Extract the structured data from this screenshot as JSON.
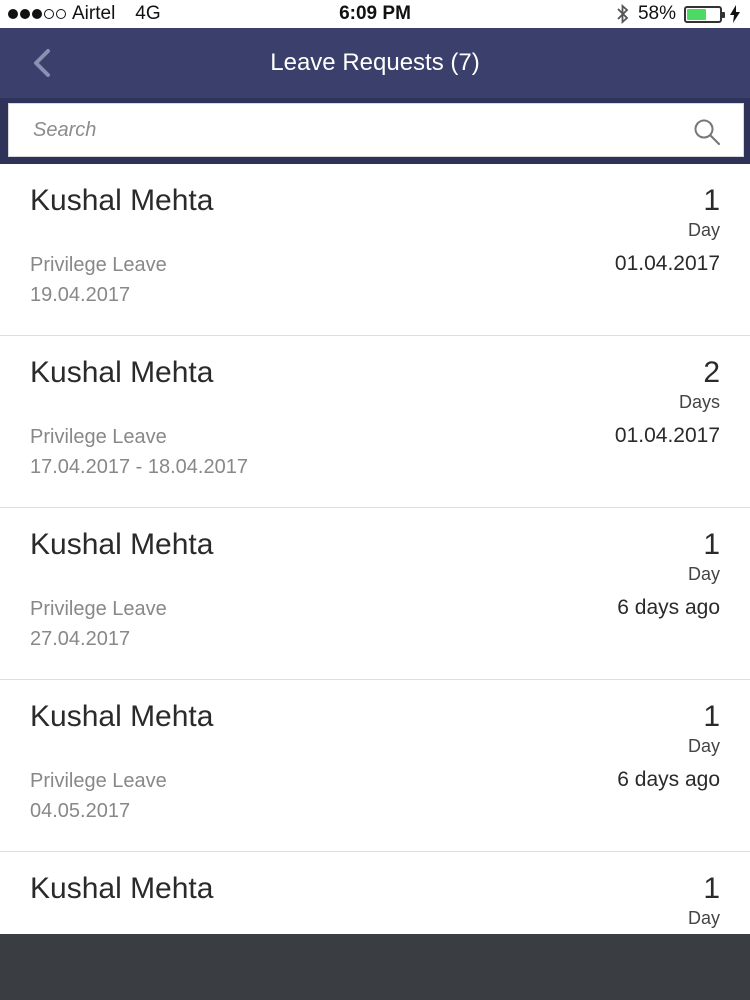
{
  "status_bar": {
    "carrier": "Airtel",
    "network": "4G",
    "time": "6:09 PM",
    "battery_percent": "58%",
    "battery_level": 0.58,
    "bluetooth_icon": "bluetooth-icon",
    "charging_icon": "bolt-icon"
  },
  "nav": {
    "title": "Leave Requests (7)",
    "back_icon": "chevron-left-icon"
  },
  "search": {
    "placeholder": "Search",
    "value": "",
    "icon": "search-icon"
  },
  "requests": [
    {
      "name": "Kushal Mehta",
      "count": "1",
      "unit": "Day",
      "type": "Privilege Leave",
      "date": "01.04.2017",
      "range": "19.04.2017"
    },
    {
      "name": "Kushal Mehta",
      "count": "2",
      "unit": "Days",
      "type": "Privilege Leave",
      "date": "01.04.2017",
      "range": "17.04.2017 - 18.04.2017"
    },
    {
      "name": "Kushal Mehta",
      "count": "1",
      "unit": "Day",
      "type": "Privilege Leave",
      "date": "6 days ago",
      "range": "27.04.2017"
    },
    {
      "name": "Kushal Mehta",
      "count": "1",
      "unit": "Day",
      "type": "Privilege Leave",
      "date": "6 days ago",
      "range": "04.05.2017"
    },
    {
      "name": "Kushal Mehta",
      "count": "1",
      "unit": "Day",
      "type": "",
      "date": "",
      "range": ""
    }
  ],
  "colors": {
    "nav_bg": "#3a3f6c",
    "search_bg": "#2f335a",
    "battery_green": "#4cd964",
    "bottom_bar": "#3a3d42"
  }
}
